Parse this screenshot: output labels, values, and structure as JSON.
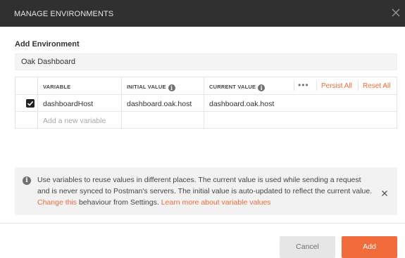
{
  "dialog": {
    "title": "MANAGE ENVIRONMENTS",
    "close_icon": "close-icon"
  },
  "form": {
    "section_label": "Add Environment",
    "environment_name": "Oak Dashboard"
  },
  "table": {
    "headers": {
      "variable": "VARIABLE",
      "initial_value": "INITIAL VALUE",
      "current_value": "CURRENT VALUE",
      "more": "•••",
      "persist_all": "Persist All",
      "reset_all": "Reset All"
    },
    "rows": [
      {
        "checked": true,
        "variable": "dashboardHost",
        "initial_value": "dashboard.oak.host",
        "current_value": "dashboard.oak.host"
      }
    ],
    "new_row_placeholder": "Add a new variable"
  },
  "banner": {
    "text_main": "Use variables to reuse values in different places. The current value is used while sending a request and is never synced to Postman's servers. The initial value is auto-updated to reflect the current value. ",
    "link_change": "Change this",
    "text_mid": " behaviour from Settings. ",
    "link_learn": "Learn more about variable values"
  },
  "footer": {
    "cancel_label": "Cancel",
    "add_label": "Add"
  },
  "colors": {
    "accent": "#f26b3a",
    "titlebar": "#303030"
  }
}
